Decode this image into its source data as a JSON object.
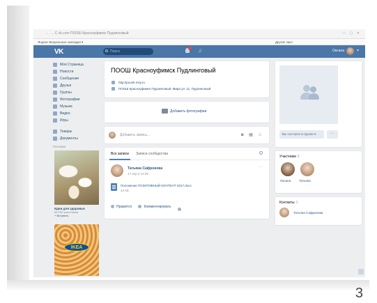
{
  "slide": {
    "page_number": "3"
  },
  "browser": {
    "url": "← → C  vk.com  ПООШ Красноуфимск Пудлинговый",
    "bookmarks": "Яндекс  Визуальные закладки ▾",
    "bookmarks_right": "Другие закл"
  },
  "header": {
    "logo": "VK",
    "search_placeholder": "Поиск",
    "user_name": "Оксана",
    "chevron": "▾"
  },
  "sidebar": {
    "items": [
      {
        "label": "Моя Страница",
        "icon": "home-icon"
      },
      {
        "label": "Новости",
        "icon": "news-icon"
      },
      {
        "label": "Сообщения",
        "icon": "messages-icon"
      },
      {
        "label": "Друзья",
        "icon": "friends-icon"
      },
      {
        "label": "Группы",
        "icon": "groups-icon"
      },
      {
        "label": "Фотографии",
        "icon": "photos-icon"
      },
      {
        "label": "Музыка",
        "icon": "music-icon"
      },
      {
        "label": "Видео",
        "icon": "video-icon"
      },
      {
        "label": "Игры",
        "icon": "games-icon"
      }
    ],
    "items2": [
      {
        "label": "Товары",
        "icon": "goods-icon"
      },
      {
        "label": "Документы",
        "icon": "documents-icon"
      }
    ],
    "ad_title": "Реклама",
    "ad_caption": "Идеи для здоровья",
    "ad_members": "56 000 участников",
    "ad_join": "+ Вступить",
    "ikea": "IKEA"
  },
  "group": {
    "title": "ПООШ Красноуфимск Пудлинговый",
    "website": "http://poosh.msy.ru",
    "address": "ПООШ Красноуфимск Пудлинговый, Мира ул. 11, Пудлинговый"
  },
  "photos": {
    "add_label": "Добавить фотографии"
  },
  "composer": {
    "placeholder": "Добавить запись..."
  },
  "wall": {
    "tabs": [
      "Все записи",
      "Записи сообщества"
    ],
    "post": {
      "author": "Татьяна Сафронова",
      "date": "17 апр в 14:08",
      "doc_name": "Положение ПОЗИТИВНЫЙ КОНТЕНТ-2017.docx",
      "doc_size": "42 КБ",
      "like": "Нравится",
      "comment": "Комментировать"
    }
  },
  "right": {
    "join_label": "Вы состоите в группе ▾",
    "more_label": "···",
    "members_title": "Участники",
    "members_count": "2",
    "members": [
      {
        "name": "Оксана"
      },
      {
        "name": "Татьяна"
      }
    ],
    "contacts_title": "Контакты",
    "contacts_count": "1",
    "contact_name": "Татьяна Сафронова"
  },
  "colors": {
    "accent": "#4a76a8",
    "link": "#2a5885",
    "bg": "#edeef0"
  }
}
